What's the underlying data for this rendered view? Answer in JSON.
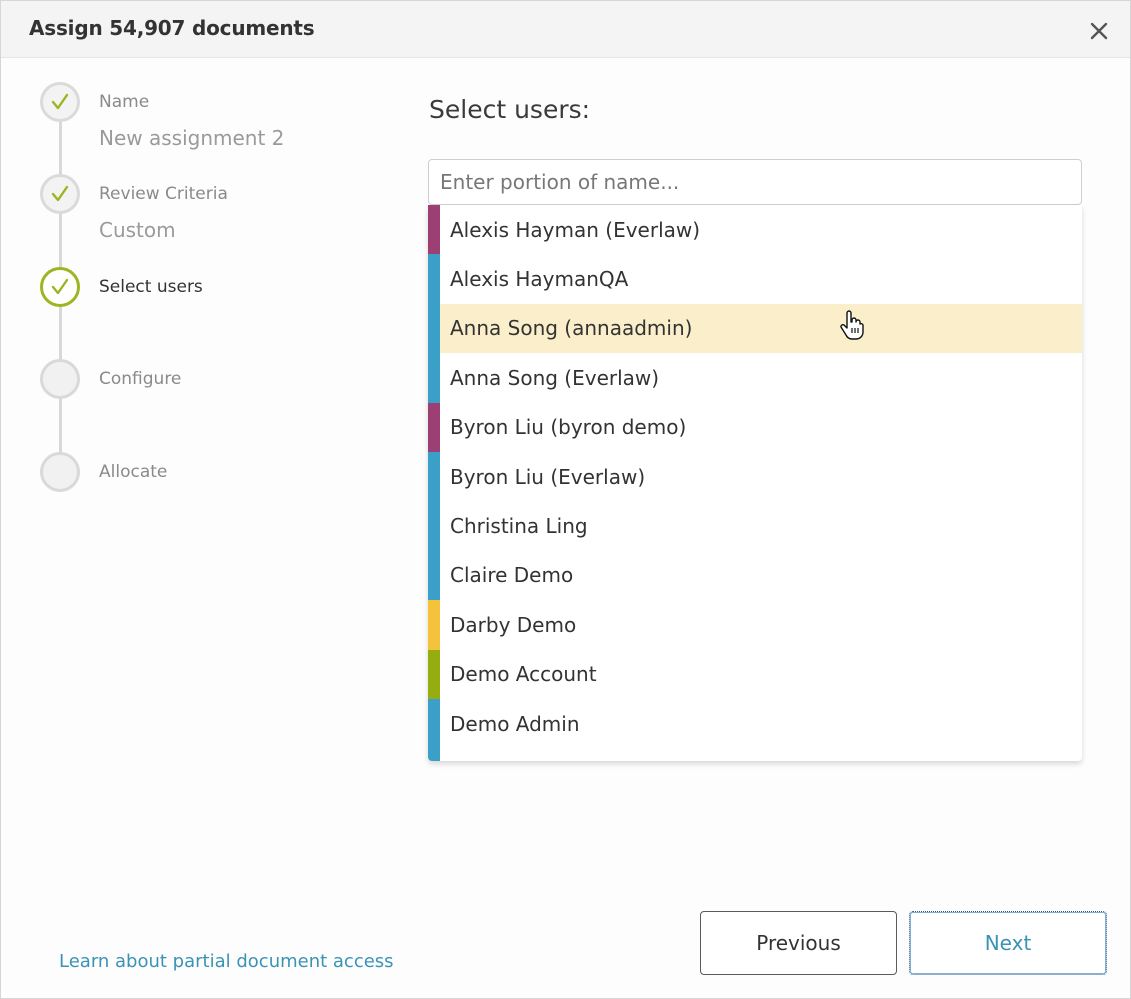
{
  "dialog": {
    "title": "Assign 54,907 documents",
    "close_icon": "close-icon"
  },
  "steps": [
    {
      "label": "Name",
      "value": "New assignment 2",
      "status": "done"
    },
    {
      "label": "Review Criteria",
      "value": "Custom",
      "status": "done"
    },
    {
      "label": "Select users",
      "value": "",
      "status": "active"
    },
    {
      "label": "Configure",
      "value": "",
      "status": "pending"
    },
    {
      "label": "Allocate",
      "value": "",
      "status": "pending"
    }
  ],
  "main": {
    "heading": "Select users:",
    "search": {
      "value": "",
      "placeholder": "Enter portion of name..."
    }
  },
  "users": [
    {
      "name": "Alexis Hayman (Everlaw)",
      "color": "#9c3f72",
      "highlighted": false
    },
    {
      "name": "Alexis HaymanQA",
      "color": "#3aa0c8",
      "highlighted": false
    },
    {
      "name": "Anna Song (annaadmin)",
      "color": "#3aa0c8",
      "highlighted": true
    },
    {
      "name": "Anna Song (Everlaw)",
      "color": "#3aa0c8",
      "highlighted": false
    },
    {
      "name": "Byron Liu (byron demo)",
      "color": "#9c3f72",
      "highlighted": false
    },
    {
      "name": "Byron Liu (Everlaw)",
      "color": "#3aa0c8",
      "highlighted": false
    },
    {
      "name": "Christina Ling",
      "color": "#3aa0c8",
      "highlighted": false
    },
    {
      "name": "Claire Demo",
      "color": "#3aa0c8",
      "highlighted": false
    },
    {
      "name": "Darby Demo",
      "color": "#f5c33b",
      "highlighted": false
    },
    {
      "name": "Demo Account",
      "color": "#96ad12",
      "highlighted": false
    },
    {
      "name": "Demo Admin",
      "color": "#3aa0c8",
      "highlighted": false
    },
    {
      "name": "",
      "color": "#3aa0c8",
      "highlighted": false
    }
  ],
  "footer": {
    "learn_link": "Learn about partial document access",
    "previous_label": "Previous",
    "next_label": "Next"
  },
  "colors": {
    "accent_green": "#9cb520",
    "link_blue": "#3a93b5",
    "highlight": "#fbeecb"
  }
}
